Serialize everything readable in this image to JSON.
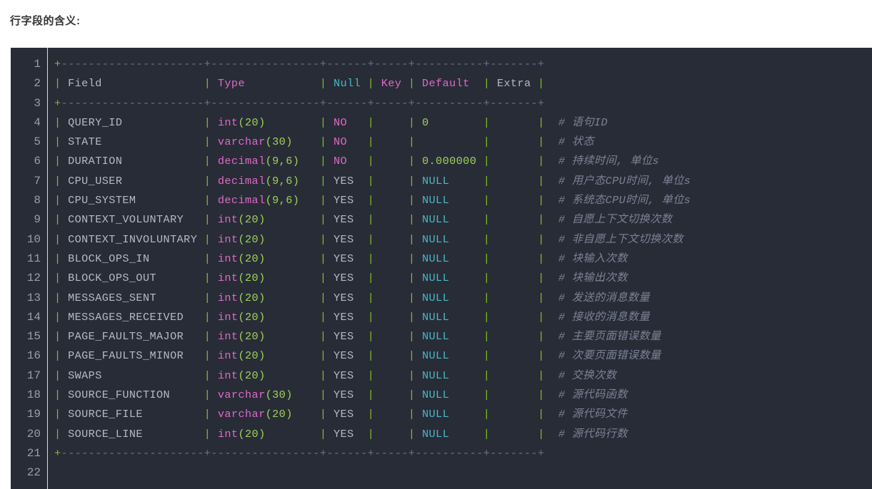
{
  "title": "行字段的含义:",
  "colors": {
    "page_bg": "#ffffff",
    "code_bg": "#282c37",
    "title_text": "#333333",
    "line_number": "#93a1b0",
    "gutter_border": "#d7dde4",
    "pipe_green": "#7fbf24",
    "rule_gray": "#6b7385",
    "plain_text": "#b3bac6",
    "type_pink": "#e069c8",
    "number_green": "#9fd356",
    "cyan": "#48b9c7",
    "comment_gray": "#7a8394"
  },
  "editor": {
    "first_line": 1,
    "last_line": 22,
    "line_numbers": [
      1,
      2,
      3,
      4,
      5,
      6,
      7,
      8,
      9,
      10,
      11,
      12,
      13,
      14,
      15,
      16,
      17,
      18,
      19,
      20,
      21,
      22
    ]
  },
  "table": {
    "rule_field": "+---------------------",
    "rule_type": "+----------------",
    "rule_null": "+------",
    "rule_key": "+-----",
    "rule_default": "+----------",
    "rule_extra": "+-------+",
    "headers": {
      "field": "Field",
      "type": "Type",
      "null": "Null",
      "key": "Key",
      "default": "Default",
      "extra": "Extra"
    },
    "rows": [
      {
        "field": "QUERY_ID",
        "type_name": "int",
        "type_args": "(20)",
        "null": "NO",
        "key": "",
        "default": "0",
        "default_kind": "num",
        "extra": "",
        "comment": "语句ID"
      },
      {
        "field": "STATE",
        "type_name": "varchar",
        "type_args": "(30)",
        "null": "NO",
        "key": "",
        "default": "",
        "default_kind": "none",
        "extra": "",
        "comment": "状态"
      },
      {
        "field": "DURATION",
        "type_name": "decimal",
        "type_args": "(9,6)",
        "null": "NO",
        "key": "",
        "default": "0.000000",
        "default_kind": "num",
        "extra": "",
        "comment": "持续时间, 单位s"
      },
      {
        "field": "CPU_USER",
        "type_name": "decimal",
        "type_args": "(9,6)",
        "null": "YES",
        "key": "",
        "default": "NULL",
        "default_kind": "null",
        "extra": "",
        "comment": "用户态CPU时间, 单位s"
      },
      {
        "field": "CPU_SYSTEM",
        "type_name": "decimal",
        "type_args": "(9,6)",
        "null": "YES",
        "key": "",
        "default": "NULL",
        "default_kind": "null",
        "extra": "",
        "comment": "系统态CPU时间, 单位s"
      },
      {
        "field": "CONTEXT_VOLUNTARY",
        "type_name": "int",
        "type_args": "(20)",
        "null": "YES",
        "key": "",
        "default": "NULL",
        "default_kind": "null",
        "extra": "",
        "comment": "自愿上下文切换次数"
      },
      {
        "field": "CONTEXT_INVOLUNTARY",
        "type_name": "int",
        "type_args": "(20)",
        "null": "YES",
        "key": "",
        "default": "NULL",
        "default_kind": "null",
        "extra": "",
        "comment": "非自愿上下文切换次数"
      },
      {
        "field": "BLOCK_OPS_IN",
        "type_name": "int",
        "type_args": "(20)",
        "null": "YES",
        "key": "",
        "default": "NULL",
        "default_kind": "null",
        "extra": "",
        "comment": "块输入次数"
      },
      {
        "field": "BLOCK_OPS_OUT",
        "type_name": "int",
        "type_args": "(20)",
        "null": "YES",
        "key": "",
        "default": "NULL",
        "default_kind": "null",
        "extra": "",
        "comment": "块输出次数"
      },
      {
        "field": "MESSAGES_SENT",
        "type_name": "int",
        "type_args": "(20)",
        "null": "YES",
        "key": "",
        "default": "NULL",
        "default_kind": "null",
        "extra": "",
        "comment": "发送的消息数量"
      },
      {
        "field": "MESSAGES_RECEIVED",
        "type_name": "int",
        "type_args": "(20)",
        "null": "YES",
        "key": "",
        "default": "NULL",
        "default_kind": "null",
        "extra": "",
        "comment": "接收的消息数量"
      },
      {
        "field": "PAGE_FAULTS_MAJOR",
        "type_name": "int",
        "type_args": "(20)",
        "null": "YES",
        "key": "",
        "default": "NULL",
        "default_kind": "null",
        "extra": "",
        "comment": "主要页面错误数量"
      },
      {
        "field": "PAGE_FAULTS_MINOR",
        "type_name": "int",
        "type_args": "(20)",
        "null": "YES",
        "key": "",
        "default": "NULL",
        "default_kind": "null",
        "extra": "",
        "comment": "次要页面错误数量"
      },
      {
        "field": "SWAPS",
        "type_name": "int",
        "type_args": "(20)",
        "null": "YES",
        "key": "",
        "default": "NULL",
        "default_kind": "null",
        "extra": "",
        "comment": "交换次数"
      },
      {
        "field": "SOURCE_FUNCTION",
        "type_name": "varchar",
        "type_args": "(30)",
        "null": "YES",
        "key": "",
        "default": "NULL",
        "default_kind": "null",
        "extra": "",
        "comment": "源代码函数"
      },
      {
        "field": "SOURCE_FILE",
        "type_name": "varchar",
        "type_args": "(20)",
        "null": "YES",
        "key": "",
        "default": "NULL",
        "default_kind": "null",
        "extra": "",
        "comment": "源代码文件"
      },
      {
        "field": "SOURCE_LINE",
        "type_name": "int",
        "type_args": "(20)",
        "null": "YES",
        "key": "",
        "default": "NULL",
        "default_kind": "null",
        "extra": "",
        "comment": "源代码行数"
      }
    ],
    "comment_marker": "#"
  }
}
